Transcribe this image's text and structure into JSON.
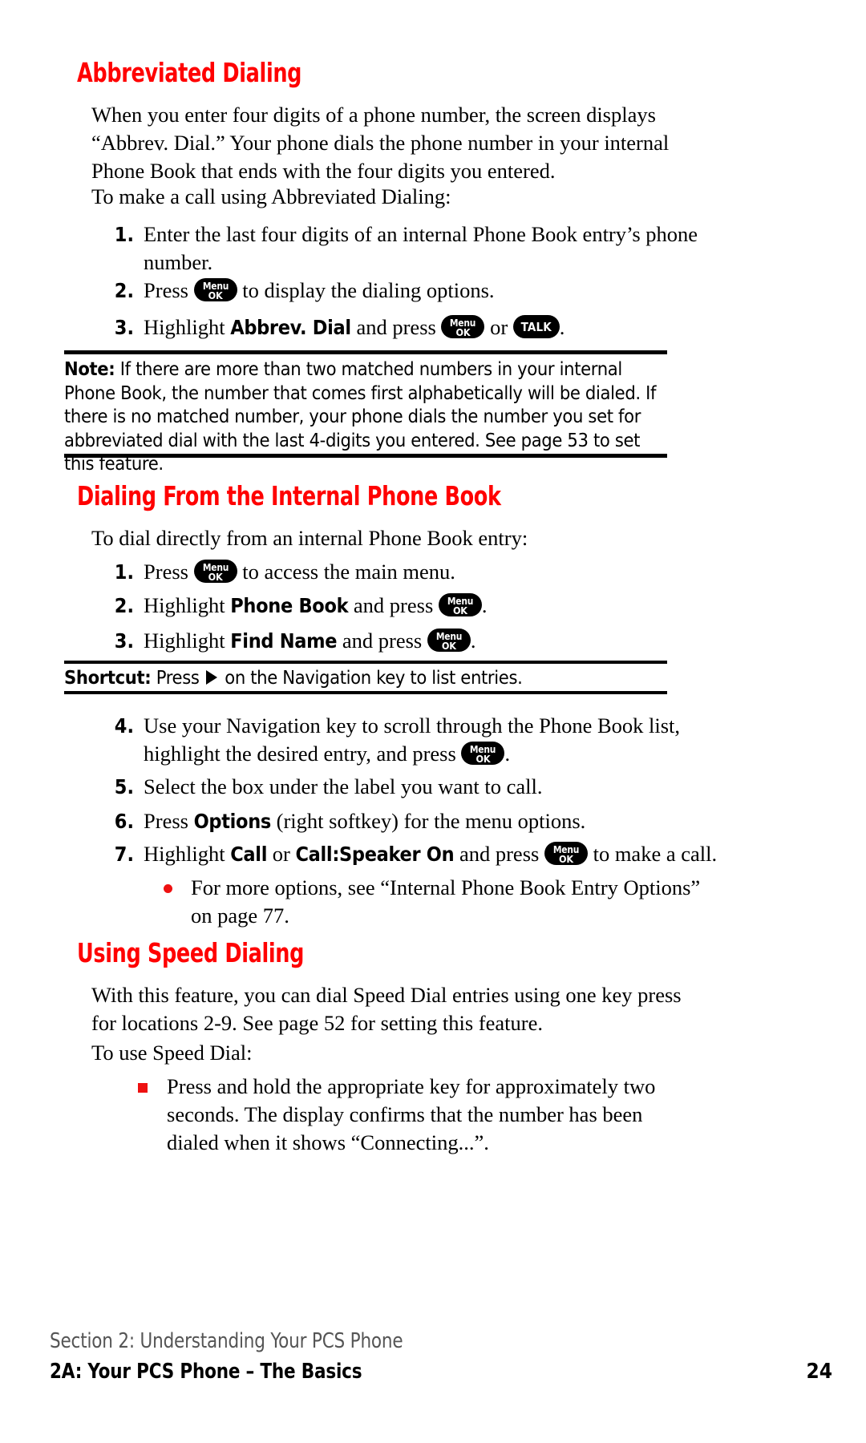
{
  "page": {
    "number": "24",
    "heading_color": "#ff0000",
    "bullet_color": "#ee1111"
  },
  "sections": [
    {
      "id": "abbreviated-dialing",
      "heading": "Abbreviated Dialing",
      "intro_paragraph": "When you enter four digits of a phone number, the screen displays “Abbrev. Dial.”  Your phone dials the phone number in your internal Phone Book that ends with the four digits you entered.",
      "lead_in": "To make a call using Abbreviated Dialing:",
      "steps": [
        {
          "num": "1.",
          "pre": "Enter the last four digits of an internal Phone Book entry’s phone number.",
          "post": ""
        },
        {
          "num": "2.",
          "pre": "Press ",
          "post": " to display the dialing options."
        },
        {
          "num": "3.",
          "pre": "Highlight ",
          "bold": "Abbrev. Dial",
          "mid": " and press ",
          "or": " or ",
          "post": "."
        }
      ]
    },
    {
      "id": "dialing-from-internal-phone-book",
      "heading": "Dialing From the Internal Phone Book",
      "lead_in": "To dial directly from an internal Phone Book entry:",
      "steps": [
        {
          "num": "1.",
          "pre": "Press ",
          "post": " to access the main menu."
        },
        {
          "num": "2.",
          "pre": "Highlight ",
          "bold": "Phone Book",
          "mid": " and press ",
          "post": "."
        },
        {
          "num": "3.",
          "pre": "Highlight ",
          "bold": "Find Name",
          "mid": " and press ",
          "post": "."
        },
        {
          "num": "4.",
          "pre": "Use your Navigation key to scroll through the Phone Book list, highlight the desired entry, and press ",
          "post": "."
        },
        {
          "num": "5.",
          "pre": "Select the box under the label you want to call.",
          "post": ""
        },
        {
          "num": "6.",
          "pre": "Press ",
          "bold": "Options",
          "mid": " (right softkey) for the menu options.",
          "post": ""
        },
        {
          "num": "7.",
          "pre": "Highlight ",
          "bold": "Call",
          "mid": " or ",
          "bold2": "Call:Speaker On",
          "mid2": " and press ",
          "post": " to make a call."
        }
      ],
      "sub_bullet": "For more options, see “Internal Phone Book Entry Options” on page 77."
    },
    {
      "id": "using-speed-dialing",
      "heading": "Using Speed Dialing",
      "intro_paragraph": "With this feature, you can dial Speed Dial entries using one key press for locations 2-9. See page 52 for setting this feature.",
      "lead_in": "To use Speed Dial:",
      "square_bullet": "Press and hold the appropriate key for approximately two seconds. The display confirms that the number has been dialed when it shows “Connecting...”."
    }
  ],
  "note_box": {
    "label": "Note:",
    "text": " If there are more than two matched numbers in your internal Phone Book, the number that comes first alphabetically will be dialed. If there is no matched number, your phone dials the number you set for abbreviated dial with the last 4-digits you entered. See page 53 to set this feature."
  },
  "shortcut_box": {
    "label": "Shortcut:",
    "text_before": " Press ",
    "text_after": " on the Navigation key to list entries."
  },
  "keys": {
    "menu_ok": {
      "line1": "Menu",
      "line2": "OK"
    },
    "talk": {
      "line1": "TALK"
    },
    "nav_right": "nav-right-arrow"
  },
  "footer": {
    "section_line": "Section 2: Understanding Your PCS Phone",
    "chapter_line": "2A: Your PCS Phone – The Basics",
    "page_number": "24"
  }
}
